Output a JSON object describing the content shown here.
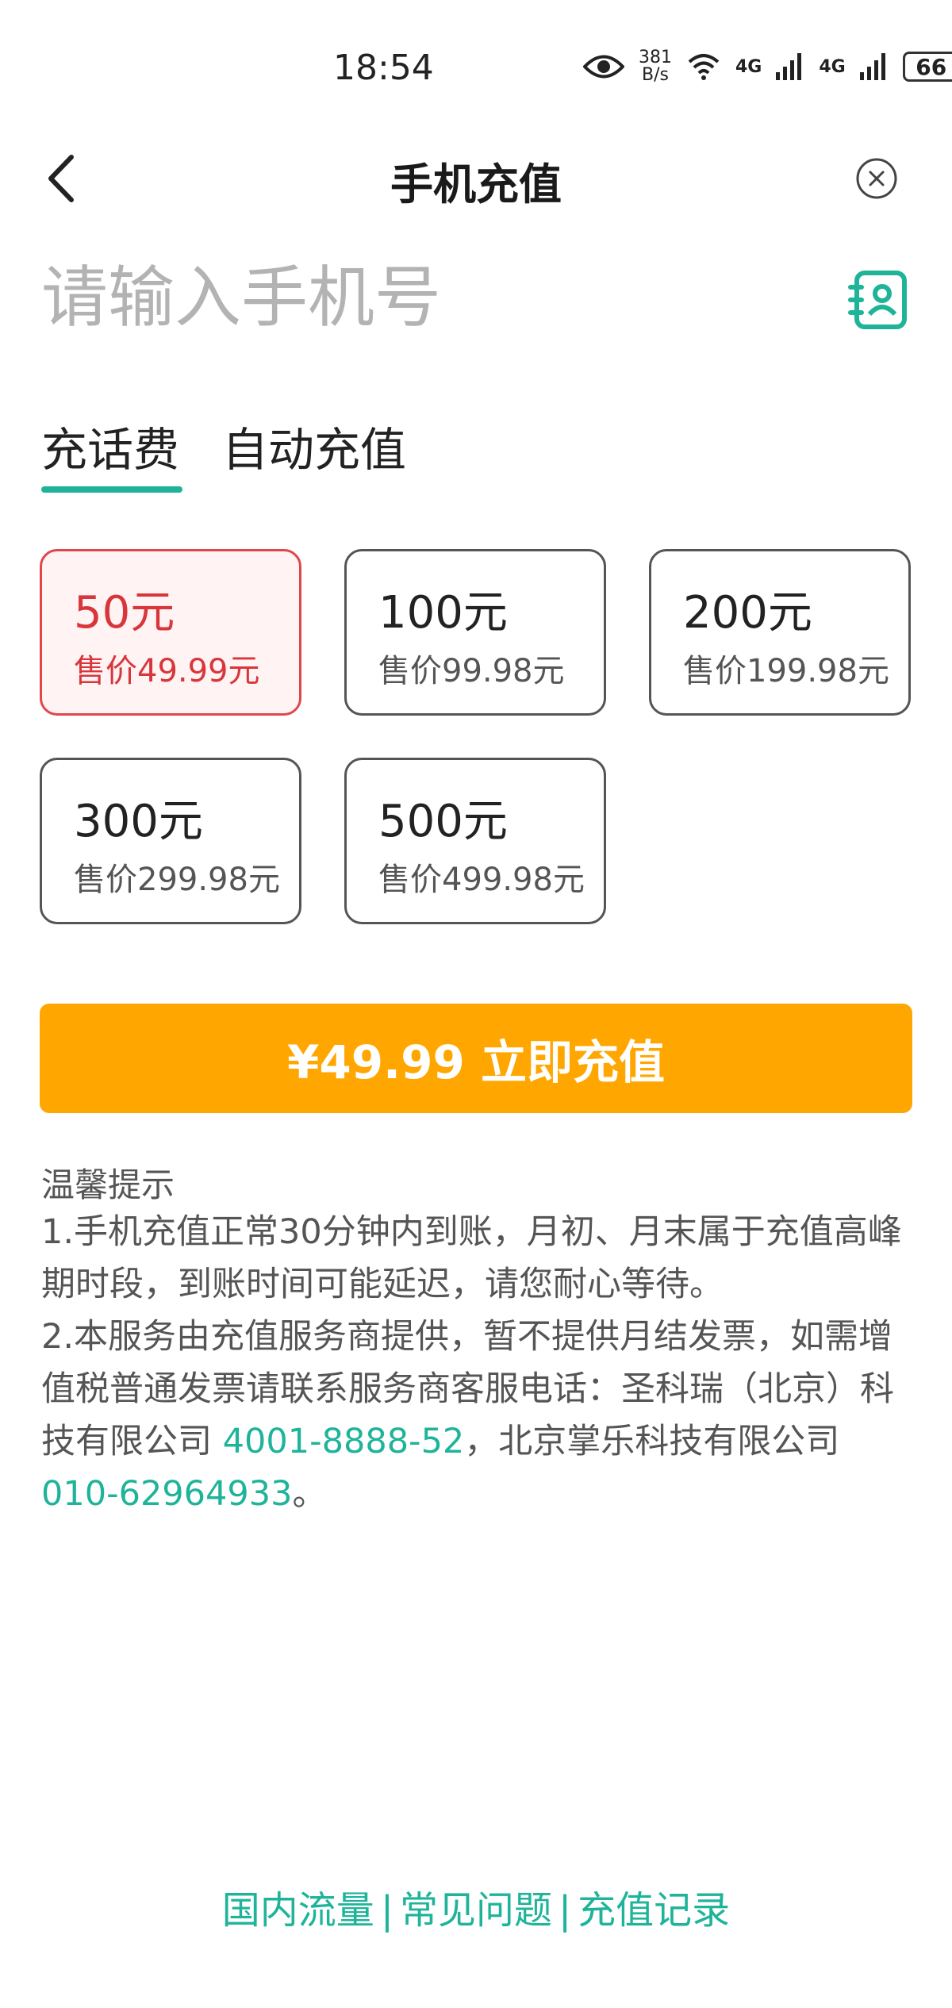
{
  "status_bar": {
    "time": "18:54",
    "net_speed_value": "381",
    "net_speed_unit": "B/s",
    "signal1": "4G",
    "signal2": "4G",
    "battery": "66"
  },
  "header": {
    "title": "手机充值"
  },
  "phone": {
    "placeholder": "请输入手机号",
    "value": ""
  },
  "tabs": [
    {
      "label": "充话费",
      "active": true
    },
    {
      "label": "自动充值",
      "active": false
    }
  ],
  "options": [
    {
      "amount": "50元",
      "price": "售价49.99元",
      "selected": true
    },
    {
      "amount": "100元",
      "price": "售价99.98元",
      "selected": false
    },
    {
      "amount": "200元",
      "price": "售价199.98元",
      "selected": false
    },
    {
      "amount": "300元",
      "price": "售价299.98元",
      "selected": false
    },
    {
      "amount": "500元",
      "price": "售价499.98元",
      "selected": false
    }
  ],
  "pay_button": {
    "label": "¥49.99 立即充值"
  },
  "tips": {
    "title": "温馨提示",
    "line1": "1.手机充值正常30分钟内到账，月初、月末属于充值高峰期时段，到账时间可能延迟，请您耐心等待。",
    "line2_prefix": "2.本服务由充值服务商提供，暂不提供月结发票，如需增值税普通发票请联系服务商客服电话：圣科瑞（北京）科技有限公司 ",
    "phone1": "4001-8888-52",
    "line2_middle": "，北京掌乐科技有限公司 ",
    "phone2": "010-62964933",
    "line2_suffix": "。"
  },
  "footer": {
    "link1": "国内流量",
    "link2": "常见问题",
    "link3": "充值记录",
    "separator": "|"
  },
  "colors": {
    "accent_green": "#1fb49a",
    "pay_orange": "#ffa700",
    "selected_red": "#d8363b"
  }
}
